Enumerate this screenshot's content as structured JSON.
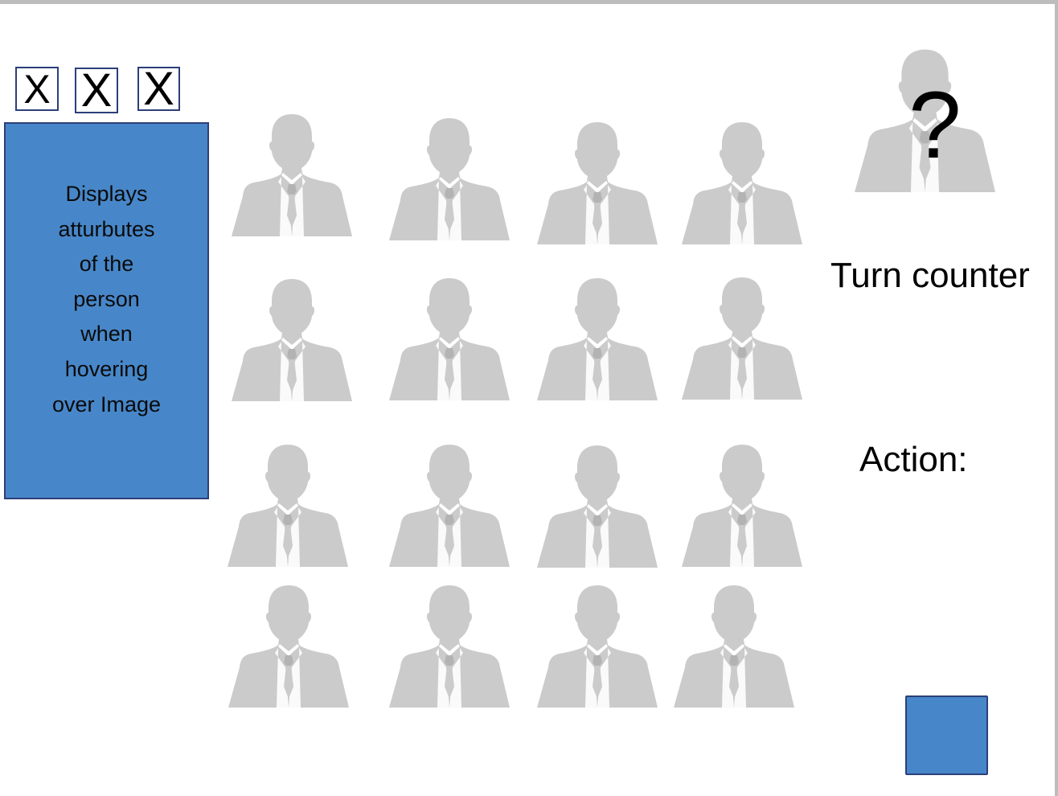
{
  "eliminated_markers": [
    {
      "label": "X"
    },
    {
      "label": "X"
    },
    {
      "label": "X"
    }
  ],
  "info_panel": {
    "text": "Displays atturbutes of the person when hovering over Image"
  },
  "grid": {
    "rows": 4,
    "columns": 4,
    "people_count": 16,
    "silhouette_color": "#cbcbcb"
  },
  "mystery_person": {
    "symbol": "?"
  },
  "turn_counter": {
    "label": "Turn counter"
  },
  "action": {
    "label": "Action:",
    "button_color": "#4787c9"
  },
  "colors": {
    "accent": "#4787c9",
    "border": "#2c3f79",
    "silhouette": "#cbcbcb"
  }
}
